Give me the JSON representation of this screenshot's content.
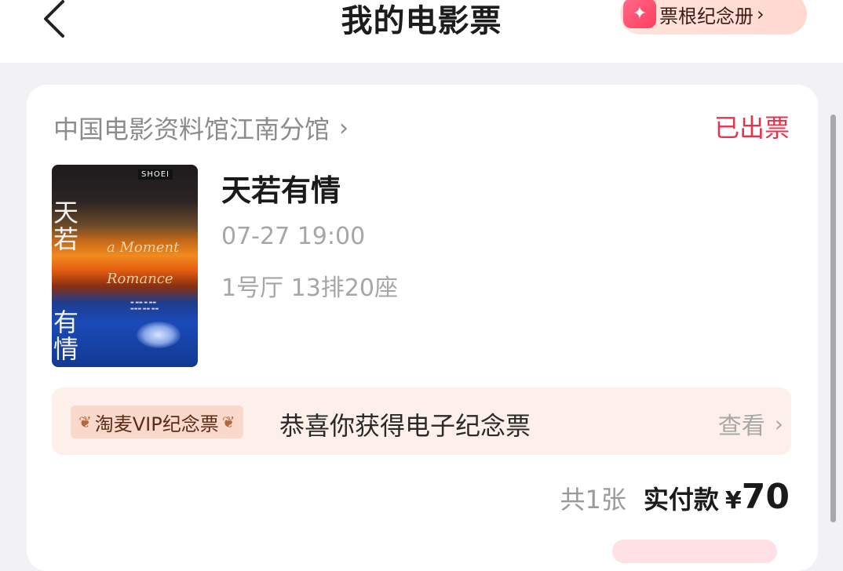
{
  "header": {
    "title": "我的电影票",
    "album_button_label": "票根纪念册",
    "album_icon": "sparkle-icon",
    "back_icon": "back-arrow-icon"
  },
  "ticket": {
    "cinema_name": "中国电影资料馆江南分馆",
    "status": "已出票",
    "movie_title": "天若有情",
    "showtime": "07-27 19:00",
    "seat": "1号厅 13排20座",
    "poster": {
      "title_top": "天若",
      "title_bottom": "有情",
      "english_line1": "a Moment",
      "english_line2": "Romance",
      "badge": "SHOEI"
    }
  },
  "souvenir": {
    "tag_label": "淘麦VIP纪念票",
    "message": "恭喜你获得电子纪念票",
    "view_label": "查看"
  },
  "summary": {
    "count_text": "共1张",
    "paid_label": "实付款",
    "currency": "¥",
    "amount": "70"
  },
  "colors": {
    "status_red": "#e8334c",
    "souvenir_bg": "#fdf0ea",
    "album_bg": "#ffe3dc"
  }
}
